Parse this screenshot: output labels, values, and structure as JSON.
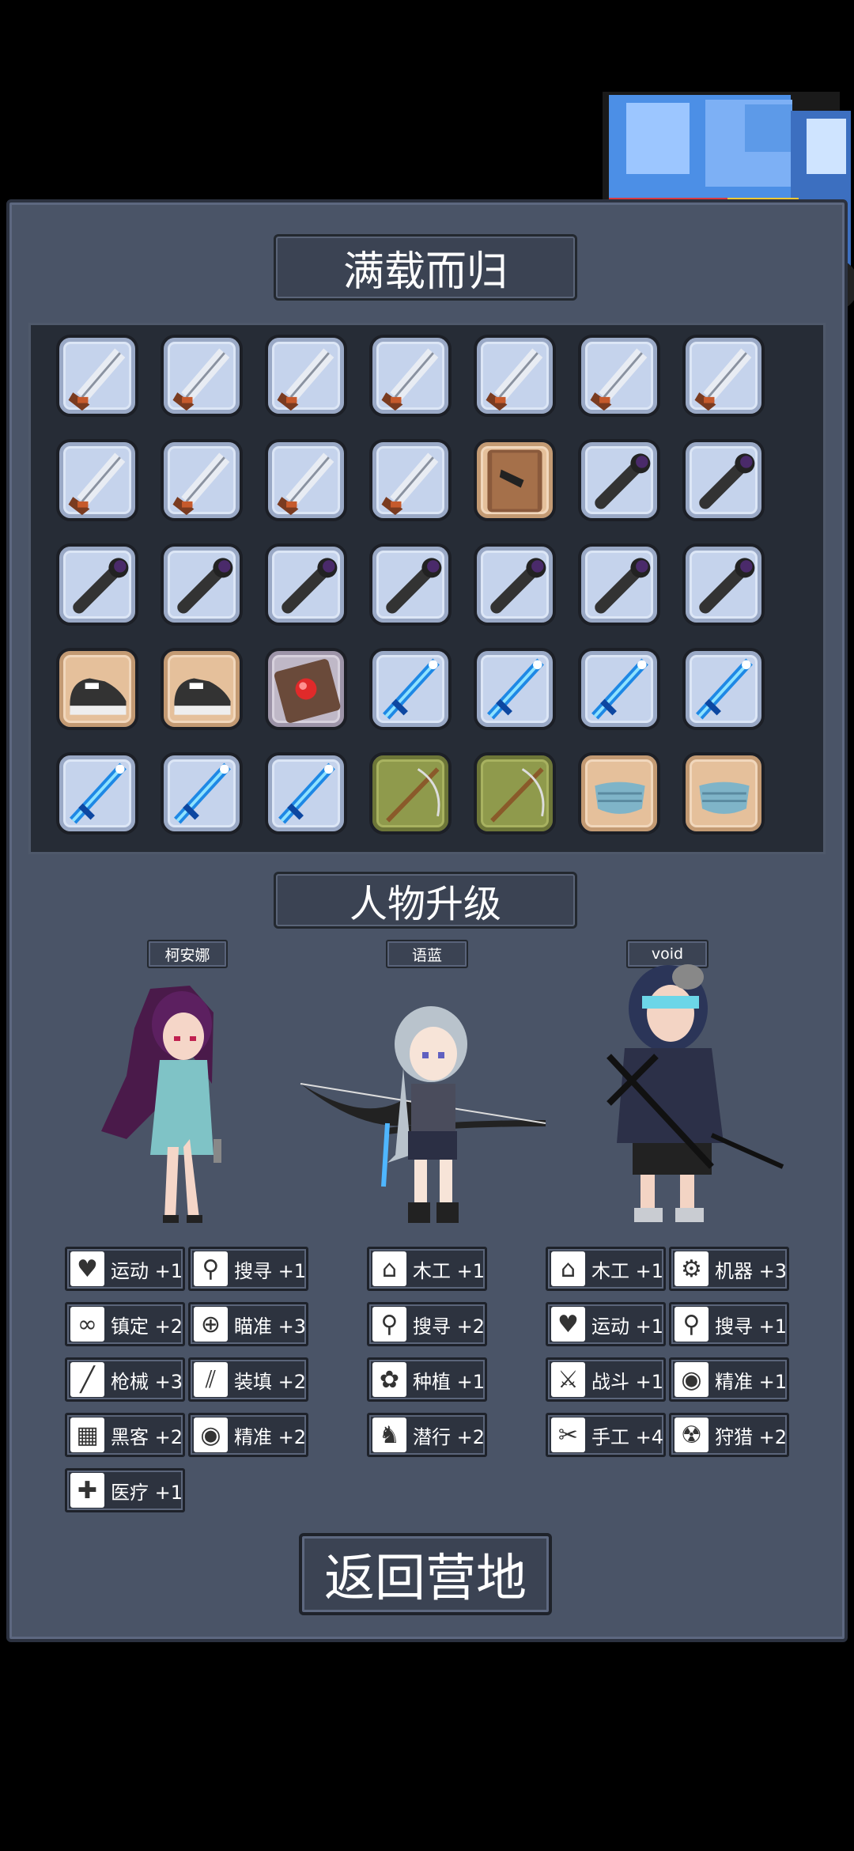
{
  "title_loot": "满载而归",
  "title_upgrade": "人物升级",
  "return_button": "返回营地",
  "inventory": [
    [
      "knife",
      "knife",
      "knife",
      "knife",
      "knife",
      "knife",
      "knife"
    ],
    [
      "knife",
      "knife",
      "knife",
      "knife",
      "book-pistol",
      "flashlight",
      "flashlight"
    ],
    [
      "flashlight",
      "flashlight",
      "flashlight",
      "flashlight",
      "flashlight",
      "flashlight",
      "flashlight"
    ],
    [
      "sneaker",
      "sneaker",
      "book-red",
      "ice-sword",
      "ice-sword",
      "ice-sword",
      "ice-sword"
    ],
    [
      "ice-sword",
      "ice-sword",
      "ice-sword",
      "bow",
      "bow",
      "mask",
      "mask"
    ]
  ],
  "characters": [
    {
      "name": "柯安娜",
      "skills": [
        {
          "icon": "heart-icon",
          "label": "运动 +1"
        },
        {
          "icon": "magnifier-icon",
          "label": "搜寻 +1"
        },
        {
          "icon": "glasses-icon",
          "label": "镇定 +2"
        },
        {
          "icon": "crosshair-icon",
          "label": "瞄准 +3"
        },
        {
          "icon": "gun-icon",
          "label": "枪械 +3"
        },
        {
          "icon": "ammo-icon",
          "label": "装填 +2"
        },
        {
          "icon": "hacker-icon",
          "label": "黑客 +2"
        },
        {
          "icon": "eye-icon",
          "label": "精准 +2"
        },
        {
          "icon": "medkit-icon",
          "label": "医疗 +1"
        }
      ]
    },
    {
      "name": "语蓝",
      "skills": [
        {
          "icon": "house-icon",
          "label": "木工 +1"
        },
        {
          "icon": "magnifier-icon",
          "label": "搜寻 +2"
        },
        {
          "icon": "plant-icon",
          "label": "种植 +1"
        },
        {
          "icon": "sneak-icon",
          "label": "潜行 +2"
        }
      ]
    },
    {
      "name": "void",
      "skills": [
        {
          "icon": "house-icon",
          "label": "木工 +1"
        },
        {
          "icon": "gear-icon",
          "label": "机器 +3"
        },
        {
          "icon": "heart-icon",
          "label": "运动 +1"
        },
        {
          "icon": "magnifier-icon",
          "label": "搜寻 +1"
        },
        {
          "icon": "fight-icon",
          "label": "战斗 +1"
        },
        {
          "icon": "eye-icon",
          "label": "精准 +1"
        },
        {
          "icon": "scissors-icon",
          "label": "手工 +4"
        },
        {
          "icon": "radiation-icon",
          "label": "狩猎 +2"
        }
      ]
    }
  ],
  "colors": {
    "panel": "#4a5467",
    "slot_blue": "#c5d3ec",
    "slot_tan": "#e5c09b"
  }
}
